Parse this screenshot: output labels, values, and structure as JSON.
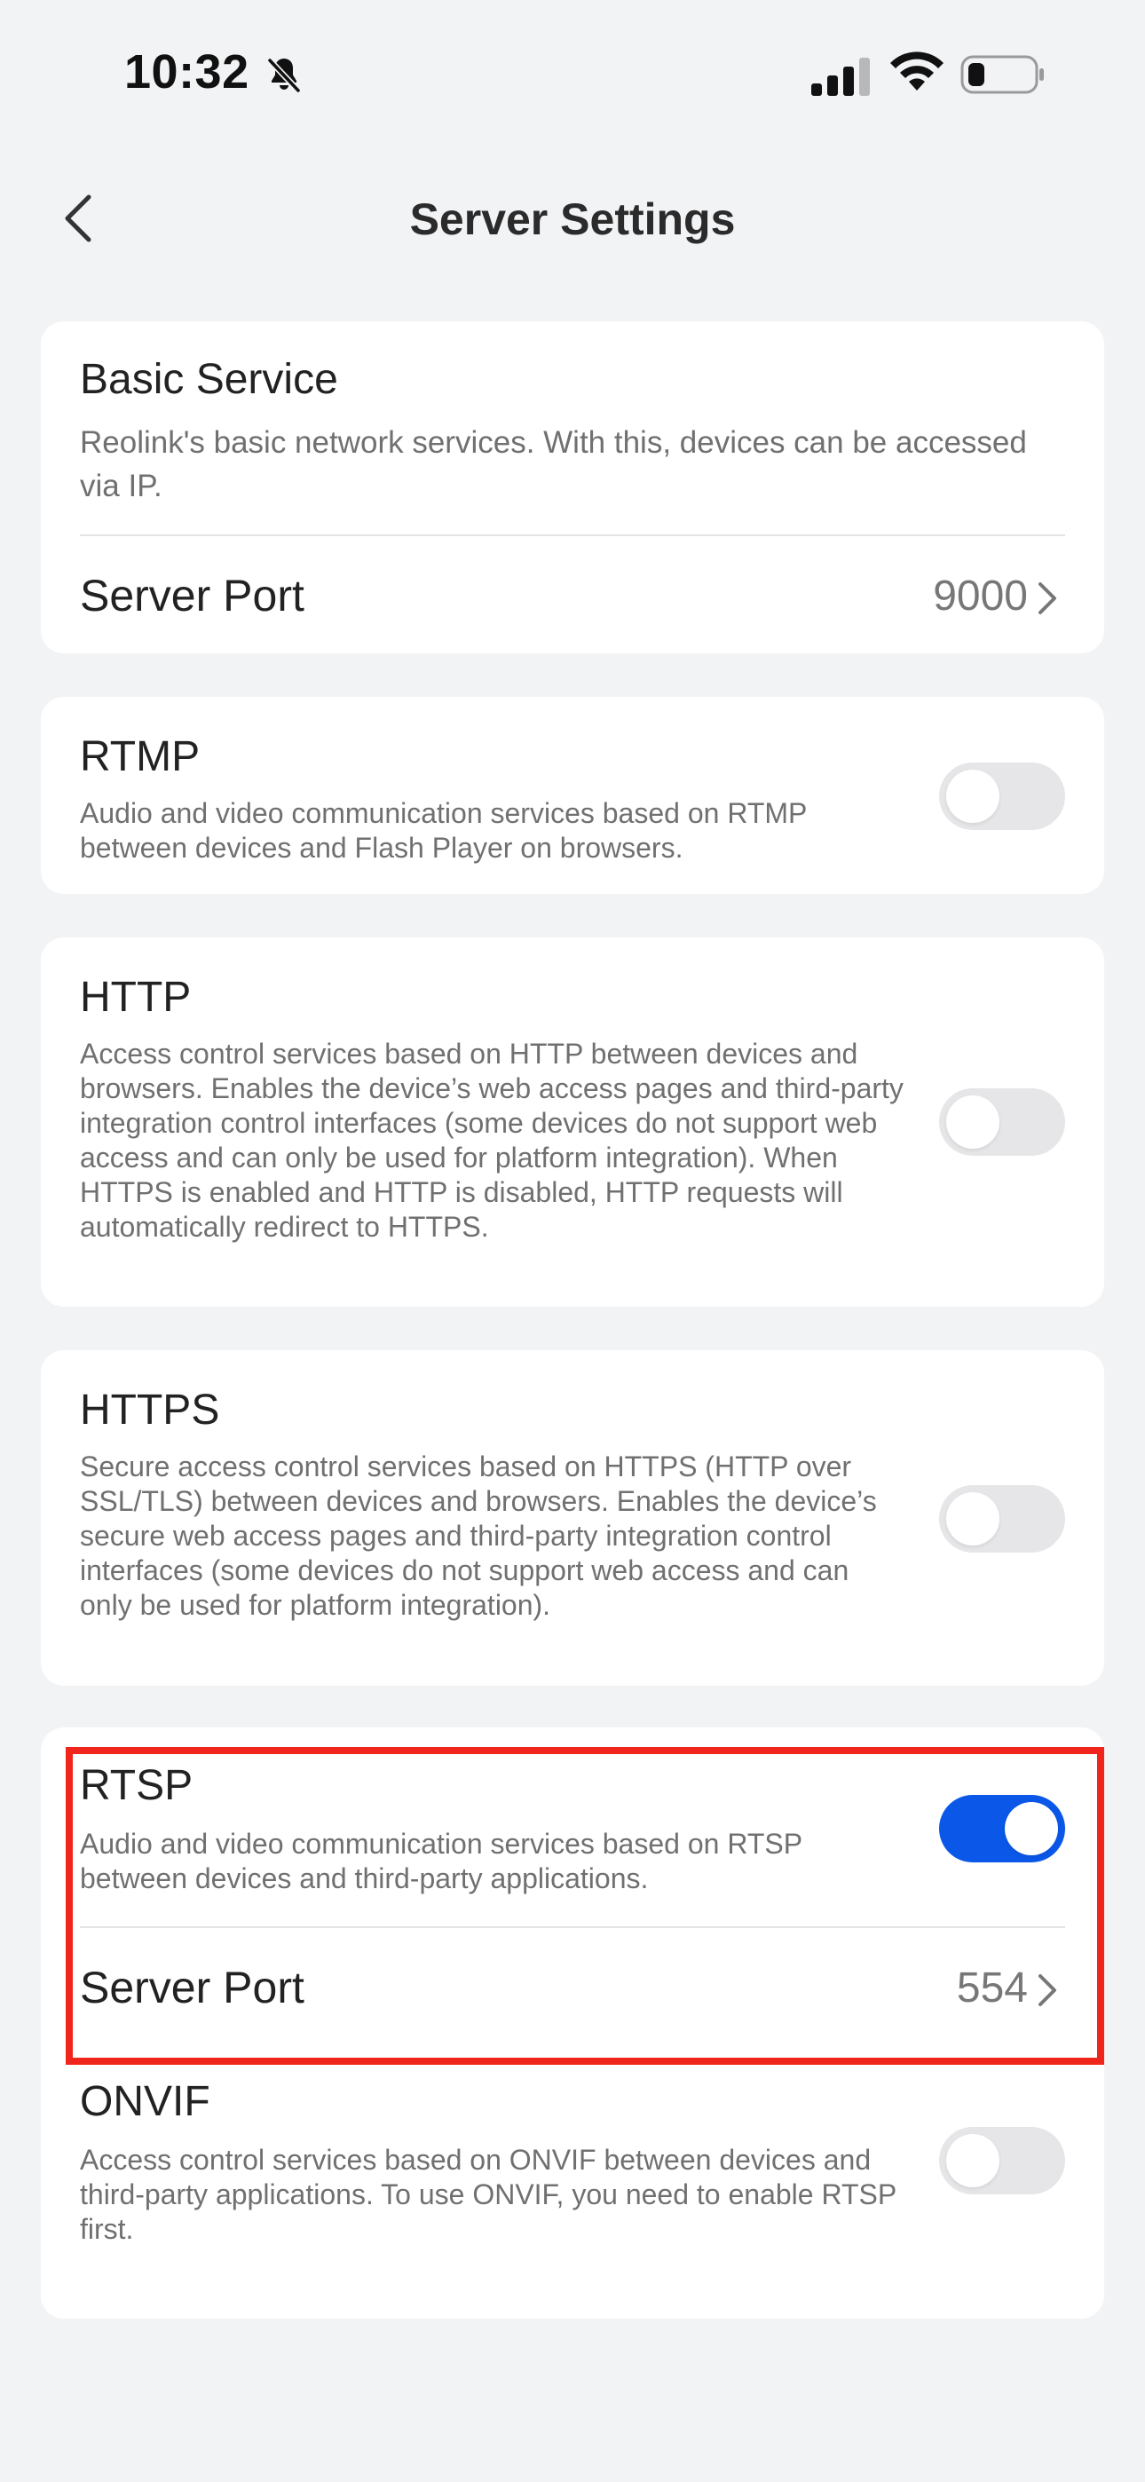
{
  "status_bar": {
    "time": "10:32",
    "icons": [
      "bell-slash-icon",
      "cellular-signal-icon",
      "wifi-icon",
      "battery-low-icon"
    ]
  },
  "nav": {
    "title": "Server Settings",
    "back_icon": "chevron-left-icon"
  },
  "basic_service": {
    "title": "Basic Service",
    "description": "Reolink's basic network services. With this, devices can be accessed via IP.",
    "port_label": "Server Port",
    "port_value": "9000"
  },
  "rtmp": {
    "title": "RTMP",
    "description": "Audio and video communication services based on RTMP between devices and Flash Player on browsers.",
    "enabled": false
  },
  "http": {
    "title": "HTTP",
    "description": "Access control services based on HTTP between devices and browsers. Enables the device’s web access pages and third-party integration control interfaces (some devices do not support web access and can only be used for platform integration). When HTTPS is enabled and HTTP is disabled, HTTP requests will automatically redirect to HTTPS.",
    "enabled": false
  },
  "https": {
    "title": "HTTPS",
    "description": "Secure access control services based on HTTPS (HTTP over SSL/TLS) between devices and browsers. Enables the device’s secure web access pages and third-party integration control interfaces (some devices do not support web access and can only be used for platform integration).",
    "enabled": false
  },
  "rtsp": {
    "title": "RTSP",
    "description": "Audio and video communication services based on RTSP between devices and third-party applications.",
    "enabled": true,
    "port_label": "Server Port",
    "port_value": "554"
  },
  "onvif": {
    "title": "ONVIF",
    "description": "Access control services based on ONVIF between devices and third-party applications. To use ONVIF, you need to enable RTSP first.",
    "enabled": false
  },
  "colors": {
    "toggle_on": "#0a57e8",
    "toggle_off": "#e6e6e8",
    "highlight": "#f0261c",
    "background": "#f2f3f5"
  }
}
